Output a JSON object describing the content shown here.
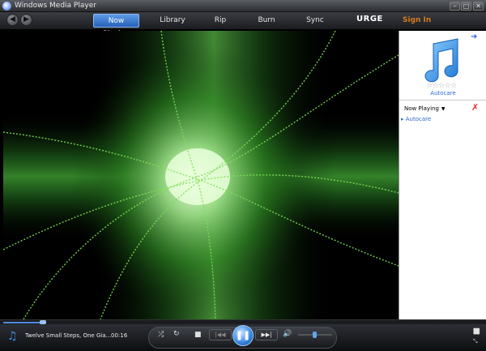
{
  "window": {
    "title": "Windows Media Player"
  },
  "nav": {
    "back_icon": "◀",
    "forward_icon": "▶",
    "tabs": [
      {
        "label": "Now Playing",
        "active": true
      },
      {
        "label": "Library"
      },
      {
        "label": "Rip"
      },
      {
        "label": "Burn"
      },
      {
        "label": "Sync"
      }
    ],
    "urge_label": "URGE",
    "sign_in_label": "Sign In"
  },
  "pane": {
    "album_name": "Autocare",
    "rating": "☆☆☆☆☆",
    "rating_value": 0,
    "now_playing_label": "Now Playing",
    "playlist_items": [
      "Autocare"
    ]
  },
  "player": {
    "track_title": "Twelve Small Steps, One Gia...",
    "elapsed": "00:16",
    "accent_color": "#3c8be6",
    "sign_in_color": "#d47b1e",
    "visualization_color": "#44c030"
  }
}
